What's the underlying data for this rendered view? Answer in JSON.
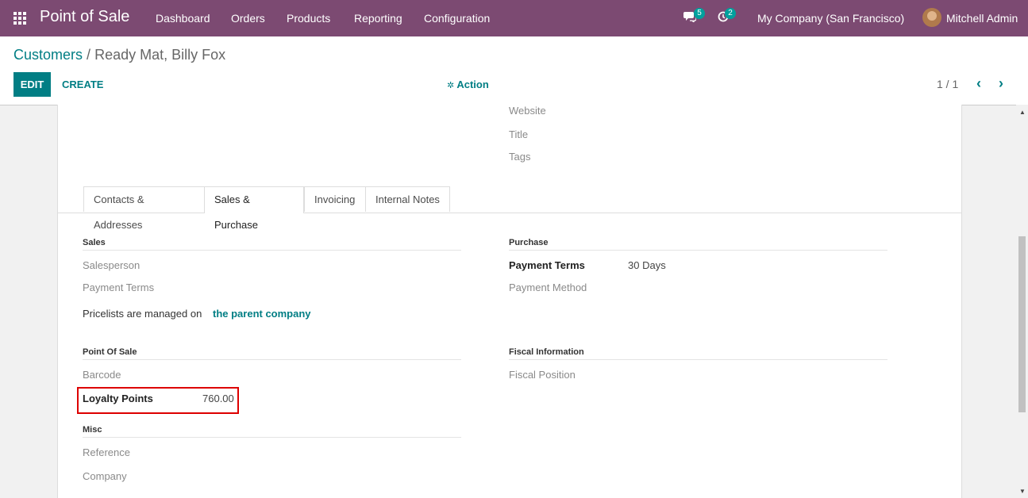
{
  "navbar": {
    "brand": "Point of Sale",
    "menu": [
      "Dashboard",
      "Orders",
      "Products",
      "Reporting",
      "Configuration"
    ],
    "messages_count": "5",
    "activities_count": "2",
    "company": "My Company (San Francisco)",
    "user": "Mitchell Admin"
  },
  "control": {
    "breadcrumb_parent": "Customers",
    "breadcrumb_sep": "/",
    "breadcrumb_current": "Ready Mat, Billy Fox",
    "edit_label": "EDIT",
    "create_label": "CREATE",
    "action_label": "Action",
    "pager": "1 / 1"
  },
  "top_fields": [
    "Website",
    "Title",
    "Tags"
  ],
  "tabs": [
    "Contacts & Addresses",
    "Sales & Purchase",
    "Invoicing",
    "Internal Notes"
  ],
  "sales": {
    "heading": "Sales",
    "salesperson": "Salesperson",
    "payment_terms": "Payment Terms",
    "pricelist_text": "Pricelists are managed on",
    "pricelist_link": "the parent company"
  },
  "purchase": {
    "heading": "Purchase",
    "payment_terms_label": "Payment Terms",
    "payment_terms_value": "30 Days",
    "payment_method": "Payment Method"
  },
  "pos": {
    "heading": "Point Of Sale",
    "barcode": "Barcode",
    "loyalty_label": "Loyalty Points",
    "loyalty_value": "760.00"
  },
  "fiscal": {
    "heading": "Fiscal Information",
    "fiscal_position": "Fiscal Position"
  },
  "misc": {
    "heading": "Misc",
    "reference": "Reference",
    "company": "Company"
  },
  "colors": {
    "navbar": "#7c4a72",
    "accent": "#017e84",
    "highlight": "#dd0000"
  }
}
